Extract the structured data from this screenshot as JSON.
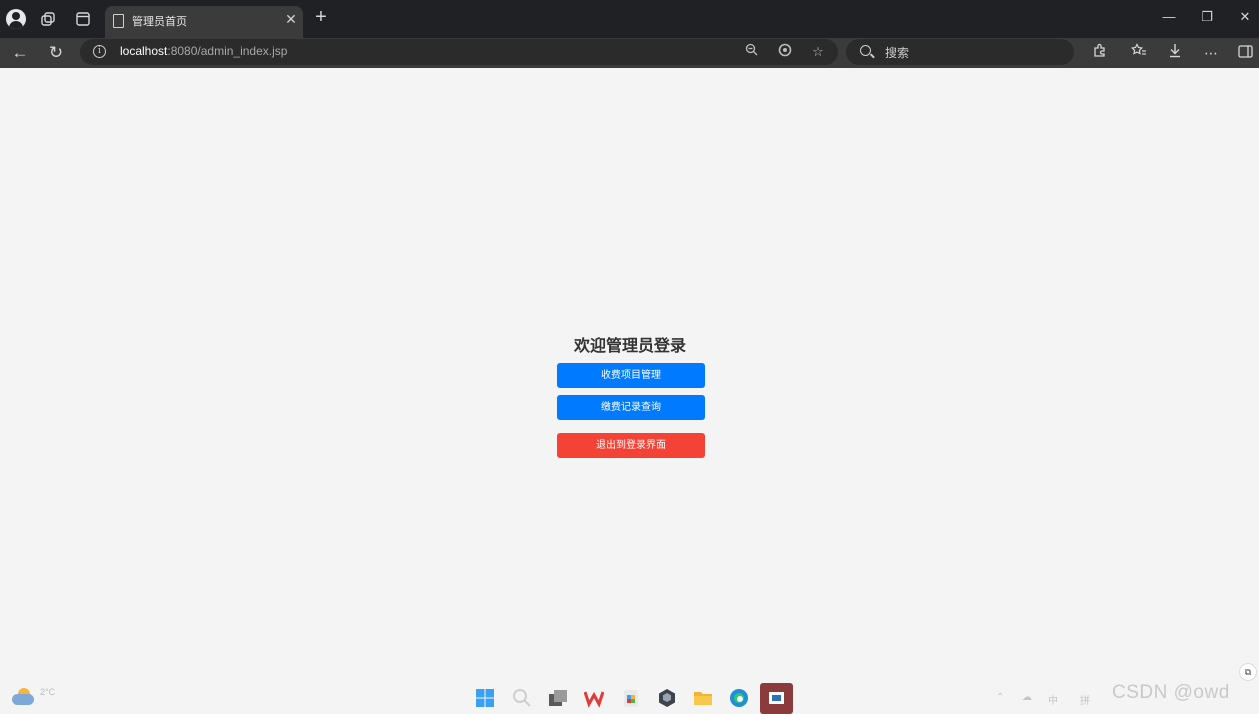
{
  "browser": {
    "tab": {
      "title": "管理员首页",
      "close": "✕"
    },
    "new_tab": "+",
    "window": {
      "minimize": "—",
      "restore": "❐",
      "close": "✕"
    },
    "nav": {
      "back": "←",
      "refresh": "↻"
    },
    "address": {
      "host": "localhost",
      "path": ":8080/admin_index.jsp"
    },
    "search_placeholder": "搜索"
  },
  "page": {
    "heading": "欢迎管理员登录",
    "buttons": {
      "fee_items": "收费项目管理",
      "payment_records": "缴费记录查询",
      "logout": "退出到登录界面"
    }
  },
  "taskbar": {
    "temperature": "2°C",
    "tray_ime": "中",
    "tray_layout": "拼"
  },
  "watermark": "CSDN @owd"
}
